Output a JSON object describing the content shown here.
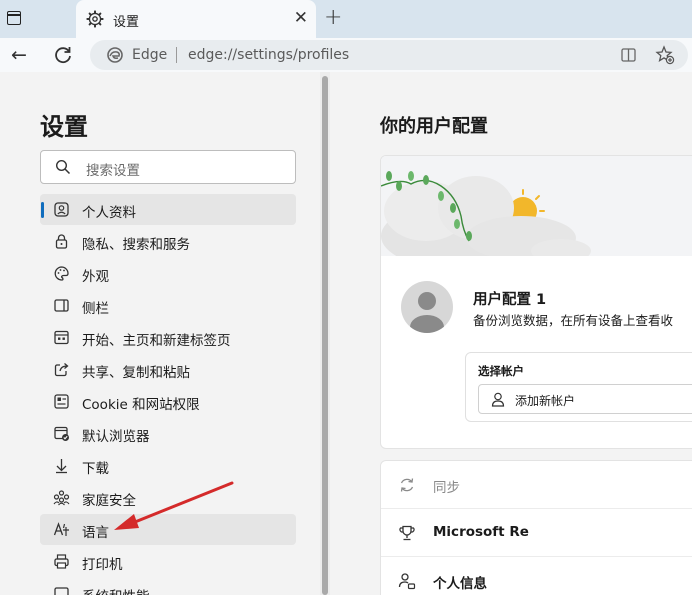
{
  "browser": {
    "tab_title": "设置",
    "tab_close": "✕",
    "new_tab": "+",
    "back": "←",
    "omnibox": {
      "brand": "Edge",
      "url": "edge://settings/profiles"
    }
  },
  "sidebar": {
    "title": "设置",
    "search_placeholder": "搜索设置",
    "items": [
      {
        "label": "个人资料",
        "icon": "profile-icon",
        "active": true
      },
      {
        "label": "隐私、搜索和服务",
        "icon": "lock-icon"
      },
      {
        "label": "外观",
        "icon": "palette-icon"
      },
      {
        "label": "侧栏",
        "icon": "sidebar-icon"
      },
      {
        "label": "开始、主页和新建标签页",
        "icon": "home-icon"
      },
      {
        "label": "共享、复制和粘贴",
        "icon": "share-icon"
      },
      {
        "label": "Cookie 和网站权限",
        "icon": "cookie-icon"
      },
      {
        "label": "默认浏览器",
        "icon": "browser-icon"
      },
      {
        "label": "下载",
        "icon": "download-icon"
      },
      {
        "label": "家庭安全",
        "icon": "family-icon"
      },
      {
        "label": "语言",
        "icon": "language-icon",
        "highlighted": true
      },
      {
        "label": "打印机",
        "icon": "printer-icon"
      },
      {
        "label": "系统和性能",
        "icon": "system-icon"
      }
    ]
  },
  "main": {
    "heading": "你的用户配置",
    "profile": {
      "name": "用户配置 1",
      "description": "备份浏览数据，在所有设备上查看收",
      "choose_account_label": "选择帐户",
      "add_account_label": "添加新帐户"
    },
    "rows": [
      {
        "label": "同步",
        "icon": "sync-icon"
      },
      {
        "label": "Microsoft Re",
        "icon": "trophy-icon"
      },
      {
        "label": "个人信息",
        "icon": "person-info-icon"
      }
    ]
  },
  "colors": {
    "accent": "#0f6cbd",
    "annotation_arrow": "#d42a2a"
  }
}
